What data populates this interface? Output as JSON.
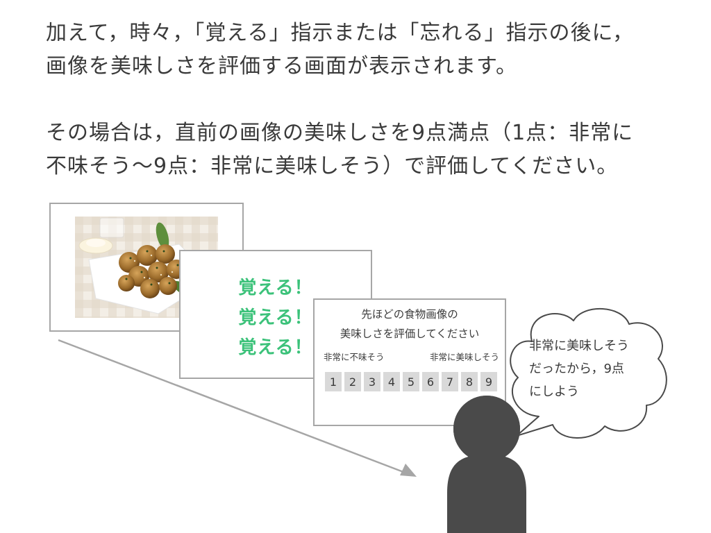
{
  "instructions": {
    "para1": [
      "加えて，時々，「覚える」指示または「忘れる」指示の後に，",
      "画像を美味しさを評価する画面が表示されます。"
    ],
    "para2": [
      "その場合は，直前の画像の美味しさを9点満点（1点：非常に",
      "不味そう〜9点：非常に美味しそう）で評価してください。"
    ]
  },
  "slides": {
    "photo": {
      "image_description": "food-photo"
    },
    "memorize": {
      "lines": [
        "覚える！",
        "覚える！",
        "覚える！"
      ],
      "color": "#3cc27a"
    },
    "rating": {
      "question": [
        "先ほどの食物画像の",
        "美味しさを評価してください"
      ],
      "anchor_low": "非常に不味そう",
      "anchor_high": "非常に美味しそう",
      "scale": [
        "1",
        "2",
        "3",
        "4",
        "5",
        "6",
        "7",
        "8",
        "9"
      ]
    }
  },
  "thought_bubble": {
    "lines": [
      "非常に美味しそう",
      "だったから，9点",
      "にしよう"
    ]
  },
  "colors": {
    "text": "#3a3a3a",
    "accent_green": "#3cc27a",
    "border": "#a6a6a6",
    "person": "#4a4a4a",
    "scale_box": "#d9d9d9"
  }
}
